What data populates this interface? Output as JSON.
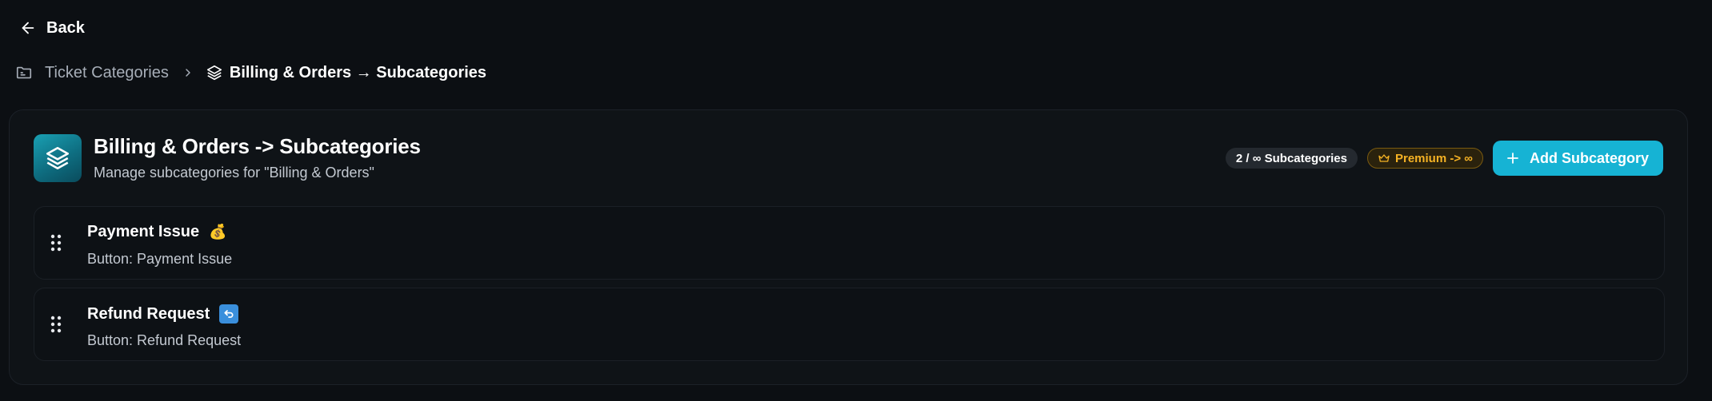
{
  "nav": {
    "back_label": "Back"
  },
  "breadcrumb": {
    "parent": "Ticket Categories",
    "current": "Billing & Orders → Subcategories"
  },
  "header": {
    "title": "Billing & Orders -> Subcategories",
    "subtitle": "Manage subcategories for \"Billing & Orders\""
  },
  "actions": {
    "count_badge": "2 / ∞ Subcategories",
    "premium_badge": "Premium -> ∞",
    "add_button": "Add Subcategory"
  },
  "subcategories": [
    {
      "name": "Payment Issue",
      "emoji": "💰",
      "button_label": "Button: Payment Issue"
    },
    {
      "name": "Refund Request",
      "emoji": "↩",
      "button_label": "Button: Refund Request"
    }
  ],
  "colors": {
    "background": "#0c0f13",
    "accent": "#16b3d4",
    "premium": "#f5b224"
  }
}
